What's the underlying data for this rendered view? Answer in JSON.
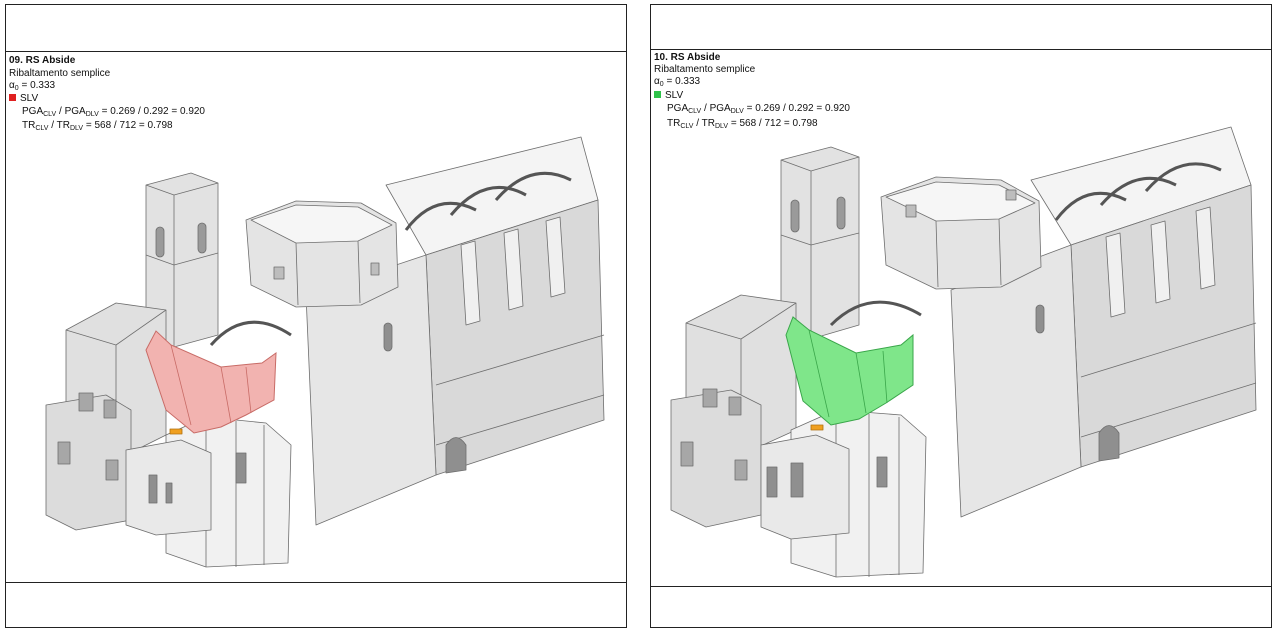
{
  "panels": [
    {
      "id": "left",
      "title": "09. RS Abside",
      "mechanism": "Ribaltamento semplice",
      "alpha_symbol": "α",
      "alpha_sub": "0",
      "alpha_value": " = 0.333",
      "legend_label": "SLV",
      "legend_color": "#e02020",
      "pga_a": "PGA",
      "pga_a_sub": "CLV",
      "pga_sep": " / PGA",
      "pga_b_sub": "DLV",
      "pga_values": " = 0.269 / 0.292 = 0.920",
      "tr_a": "TR",
      "tr_a_sub": "CLV",
      "tr_sep": " / TR",
      "tr_b_sub": "DLV",
      "tr_values": " = 568 / 712 = 0.798",
      "highlight_fill": "#f2b3b0",
      "highlight_stroke": "#c86b66"
    },
    {
      "id": "right",
      "title": "10. RS Abside",
      "mechanism": "Ribaltamento semplice",
      "alpha_symbol": "α",
      "alpha_sub": "0",
      "alpha_value": " = 0.333",
      "legend_label": "SLV",
      "legend_color": "#2fc24a",
      "pga_a": "PGA",
      "pga_a_sub": "CLV",
      "pga_sep": " / PGA",
      "pga_b_sub": "DLV",
      "pga_values": " = 0.269 / 0.292 = 0.920",
      "tr_a": "TR",
      "tr_a_sub": "CLV",
      "tr_sep": " / TR",
      "tr_b_sub": "DLV",
      "tr_values": " = 568 / 712 = 0.798",
      "highlight_fill": "#7fe68a",
      "highlight_stroke": "#3aa64a"
    }
  ]
}
